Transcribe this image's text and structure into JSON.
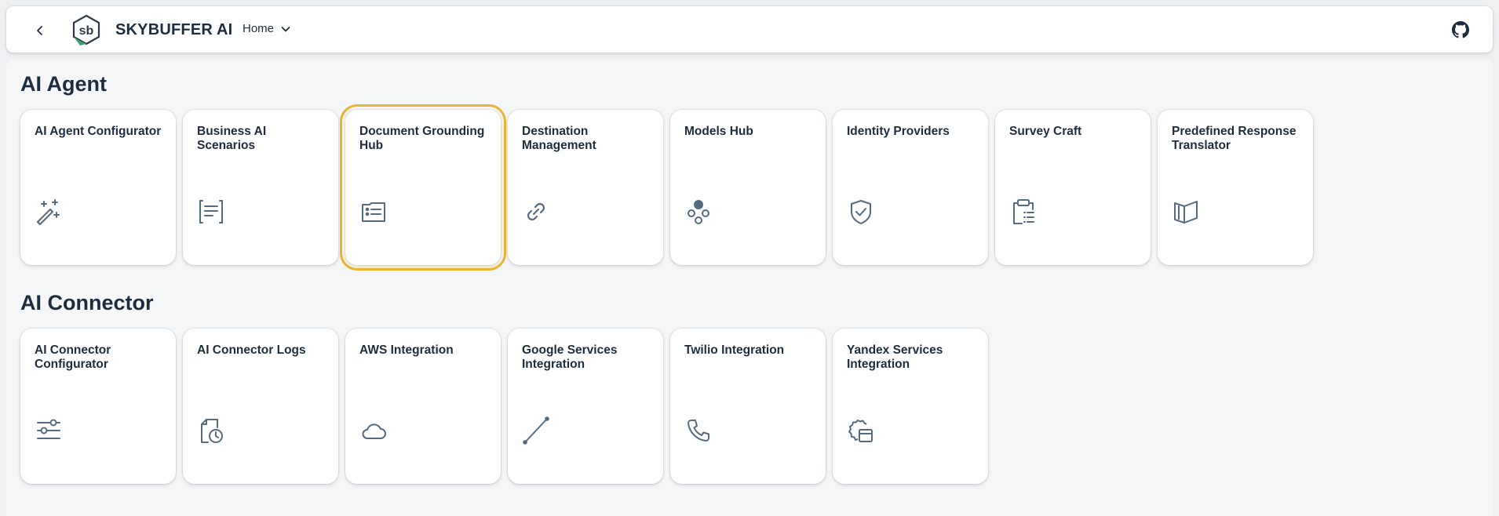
{
  "header": {
    "brand": "SKYBUFFER AI",
    "logo_text": "sb",
    "nav_label": "Home"
  },
  "sections": [
    {
      "title": "AI Agent",
      "tiles": [
        {
          "title": "AI Agent Configurator",
          "icon": "magic-wand-icon"
        },
        {
          "title": "Business AI Scenarios",
          "icon": "document-text-icon"
        },
        {
          "title": "Document Grounding Hub",
          "icon": "id-card-list-icon"
        },
        {
          "title": "Destination Management",
          "icon": "link-icon"
        },
        {
          "title": "Models Hub",
          "icon": "network-nodes-icon"
        },
        {
          "title": "Identity Providers",
          "icon": "shield-check-icon"
        },
        {
          "title": "Survey Craft",
          "icon": "clipboard-list-icon"
        },
        {
          "title": "Predefined Response Translator",
          "icon": "open-book-icon"
        }
      ]
    },
    {
      "title": "AI Connector",
      "tiles": [
        {
          "title": "AI Connector Configurator",
          "icon": "sliders-icon"
        },
        {
          "title": "AI Connector Logs",
          "icon": "document-clock-icon"
        },
        {
          "title": "AWS Integration",
          "icon": "cloud-icon"
        },
        {
          "title": "Google Services Integration",
          "icon": "line-segment-icon"
        },
        {
          "title": "Twilio Integration",
          "icon": "phone-icon"
        },
        {
          "title": "Yandex Services Integration",
          "icon": "gear-window-icon"
        }
      ]
    }
  ],
  "colors": {
    "focus_outline": "#e9b334",
    "icon": "#556b82",
    "text": "#1d2d3e"
  }
}
